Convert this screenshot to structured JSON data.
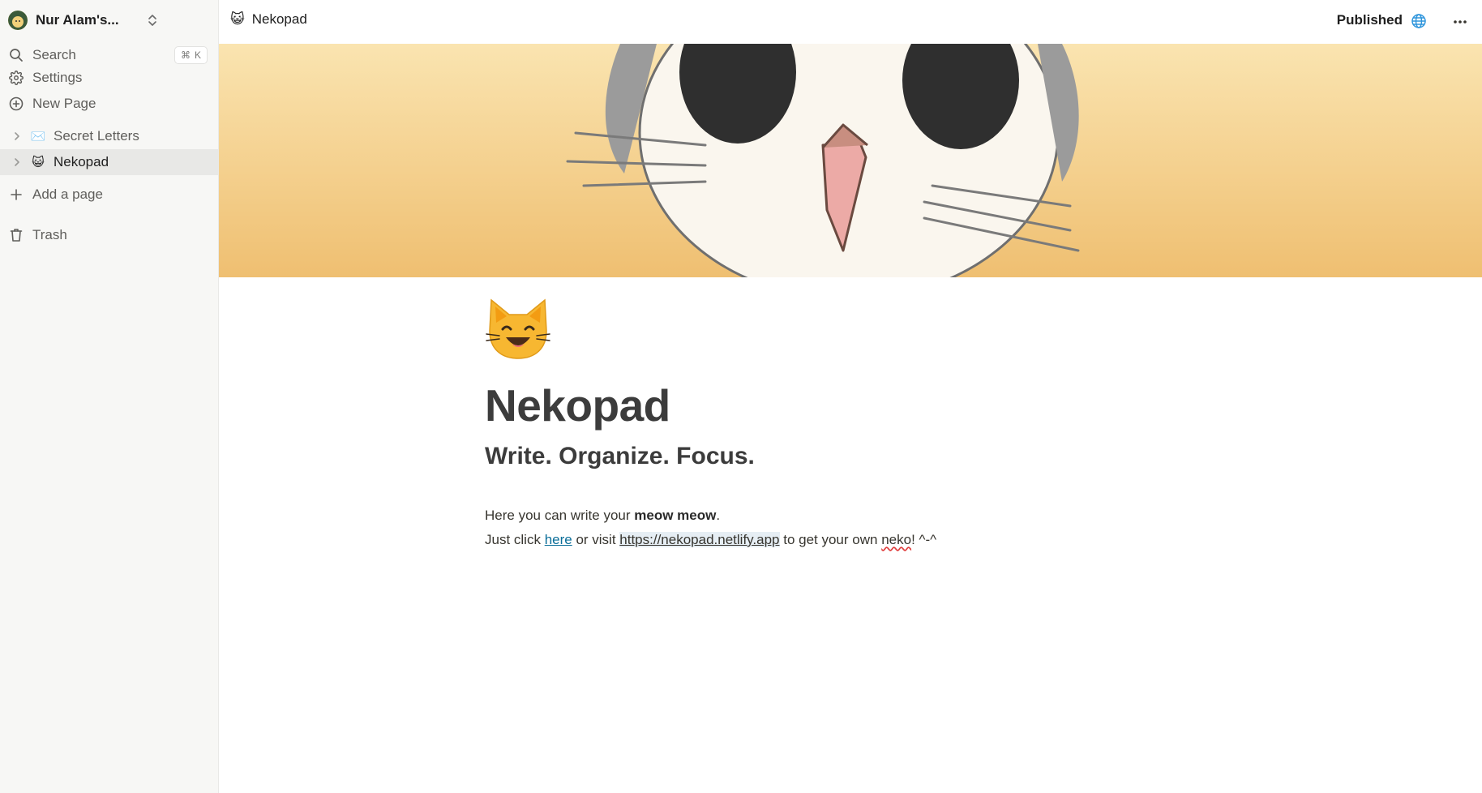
{
  "sidebar": {
    "workspace_name": "Nur Alam's...",
    "nav": {
      "search_label": "Search",
      "search_shortcut_key": "K",
      "settings_label": "Settings",
      "new_page_label": "New Page"
    },
    "pages": [
      {
        "emoji": "✉️",
        "label": "Secret Letters",
        "active": false
      },
      {
        "emoji": "😺",
        "label": "Nekopad",
        "active": true
      }
    ],
    "add_page_label": "Add a page",
    "trash_label": "Trash"
  },
  "topbar": {
    "breadcrumb_emoji": "😺",
    "breadcrumb_label": "Nekopad",
    "published_label": "Published"
  },
  "page": {
    "emoji": "😺",
    "title": "Nekopad",
    "subtitle": "Write. Organize. Focus.",
    "line1": {
      "prefix": "Here you can write your ",
      "bold": "meow meow",
      "suffix": "."
    },
    "line2": {
      "prefix": "Just click ",
      "link_text": "here",
      "middle": " or visit ",
      "url_text": "https://nekopad.netlify.app",
      "after_url": " to get your own ",
      "misspelled": "neko",
      "end": "! ^-^"
    }
  },
  "colors": {
    "accent_blue": "#2f95dc",
    "link": "#0b6e99",
    "sidebar_bg": "#f7f7f5",
    "cover_bg": "#f4c97f"
  },
  "icons": {
    "workspace_avatar": "avatar",
    "workspace_switch": "chevron-up-down-icon",
    "search": "search-icon",
    "settings": "gear-icon",
    "new_page": "plus-circle-icon",
    "expand": "chevron-right-icon",
    "add_page": "plus-icon",
    "trash": "trash-icon",
    "published": "globe-icon",
    "more": "more-horizontal-icon"
  }
}
